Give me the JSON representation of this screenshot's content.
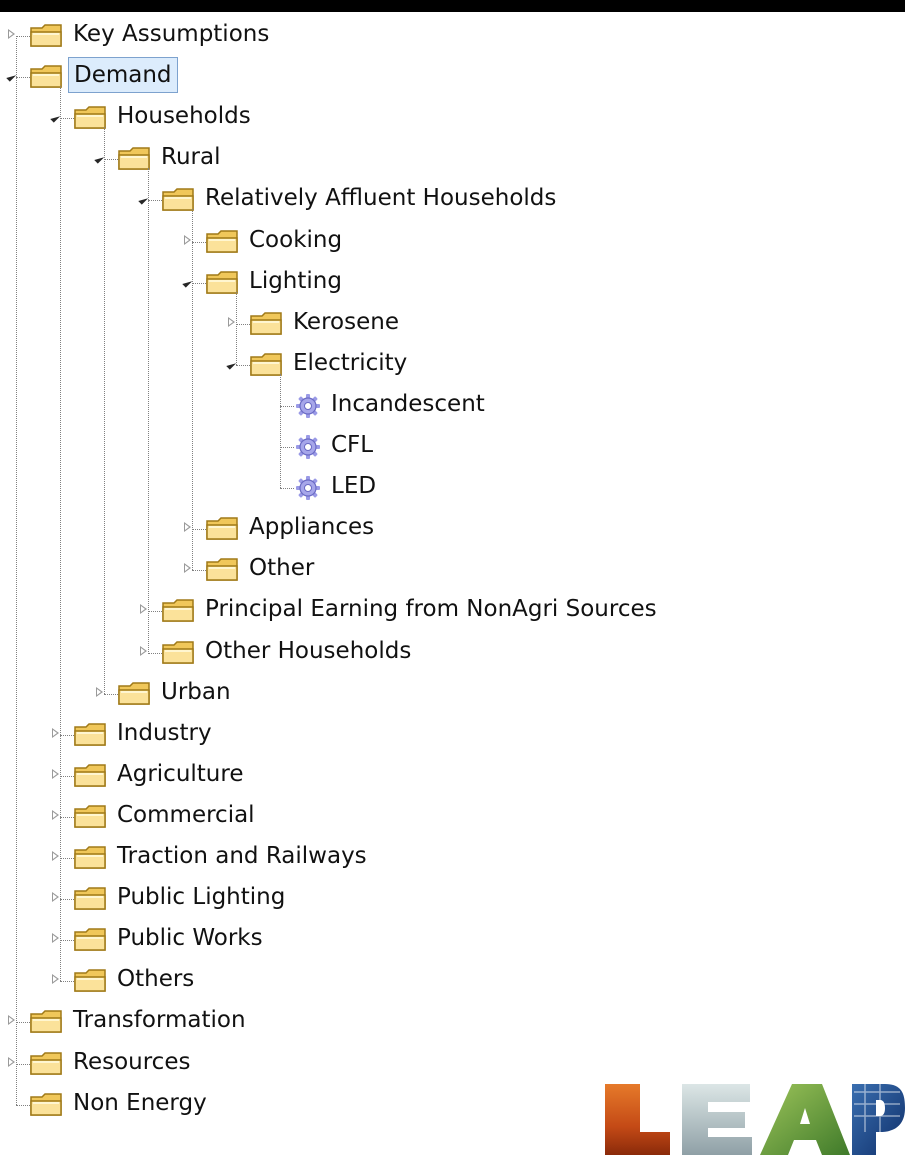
{
  "tree": {
    "root": [
      {
        "label": "Key Assumptions",
        "state": "collapsed",
        "icon": "folder-icon"
      },
      {
        "label": "Demand",
        "state": "expanded",
        "icon": "folder-icon",
        "selected": true
      },
      {
        "label": "Households",
        "state": "expanded",
        "icon": "folder-icon"
      },
      {
        "label": "Rural",
        "state": "expanded",
        "icon": "folder-icon"
      },
      {
        "label": "Relatively Affluent Households",
        "state": "expanded",
        "icon": "folder-icon"
      },
      {
        "label": "Cooking",
        "state": "collapsed",
        "icon": "folder-icon"
      },
      {
        "label": "Lighting",
        "state": "expanded",
        "icon": "folder-icon"
      },
      {
        "label": "Kerosene",
        "state": "collapsed",
        "icon": "folder-icon"
      },
      {
        "label": "Electricity",
        "state": "expanded",
        "icon": "folder-icon"
      },
      {
        "label": "Incandescent",
        "state": "leaf",
        "icon": "gear-icon"
      },
      {
        "label": "CFL",
        "state": "leaf",
        "icon": "gear-icon"
      },
      {
        "label": "LED",
        "state": "leaf",
        "icon": "gear-icon"
      },
      {
        "label": "Appliances",
        "state": "collapsed",
        "icon": "folder-icon"
      },
      {
        "label": "Other",
        "state": "collapsed",
        "icon": "folder-icon"
      },
      {
        "label": "Principal Earning from NonAgri Sources",
        "state": "collapsed",
        "icon": "folder-icon"
      },
      {
        "label": "Other Households",
        "state": "collapsed",
        "icon": "folder-icon"
      },
      {
        "label": "Urban",
        "state": "collapsed",
        "icon": "folder-icon"
      },
      {
        "label": "Industry",
        "state": "collapsed",
        "icon": "folder-icon"
      },
      {
        "label": "Agriculture",
        "state": "collapsed",
        "icon": "folder-icon"
      },
      {
        "label": "Commercial",
        "state": "collapsed",
        "icon": "folder-icon"
      },
      {
        "label": "Traction and Railways",
        "state": "collapsed",
        "icon": "folder-icon"
      },
      {
        "label": "Public Lighting",
        "state": "collapsed",
        "icon": "folder-icon"
      },
      {
        "label": "Public Works",
        "state": "collapsed",
        "icon": "folder-icon"
      },
      {
        "label": "Others",
        "state": "collapsed",
        "icon": "folder-icon"
      },
      {
        "label": "Transformation",
        "state": "collapsed",
        "icon": "folder-icon"
      },
      {
        "label": "Resources",
        "state": "collapsed",
        "icon": "folder-icon"
      },
      {
        "label": "Non Energy",
        "state": "leaf",
        "icon": "folder-icon"
      }
    ]
  },
  "logo": {
    "text": "LEAP",
    "name": "leap-logo"
  },
  "colors": {
    "selection_bg": "#dcecfc",
    "selection_border": "#7da2ce",
    "folder": "#f3d27a",
    "folder_edge": "#b8912a",
    "gear": "#8c8ce0"
  }
}
